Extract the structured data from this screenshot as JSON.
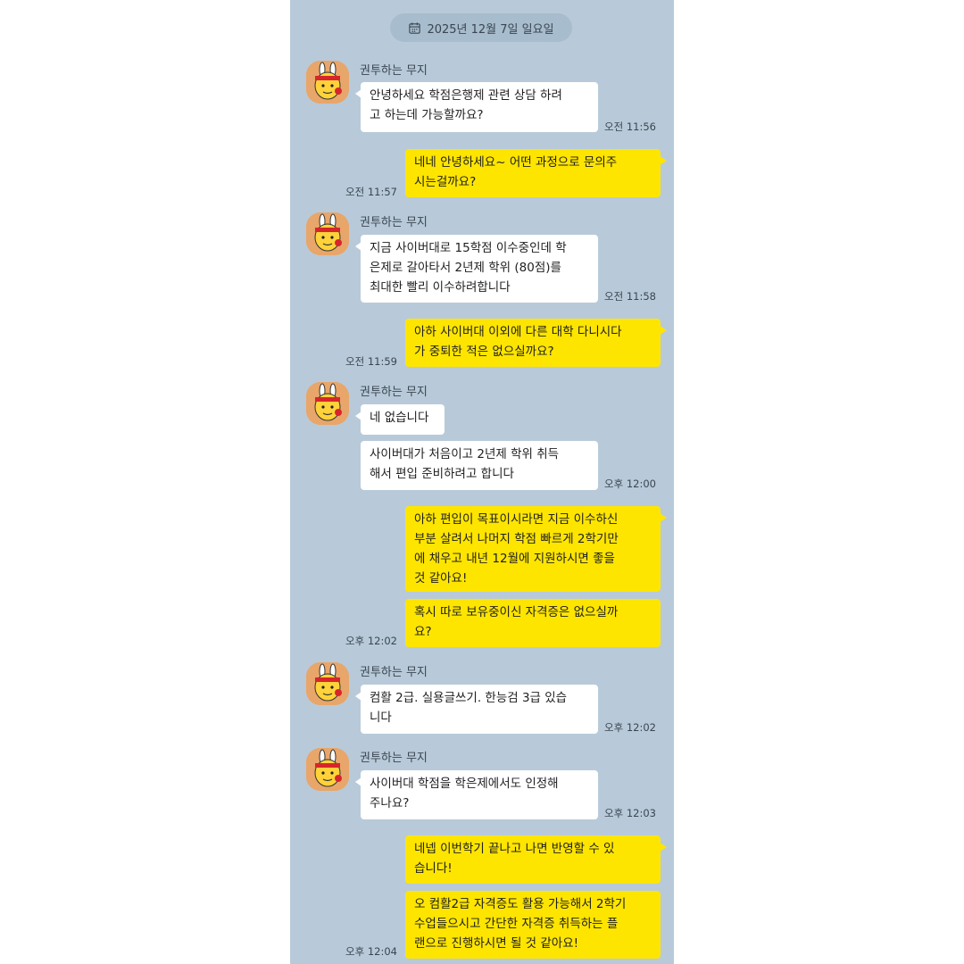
{
  "date_header": "2025년 12월 7일 일요일",
  "contact": {
    "name": "권투하는 무지"
  },
  "messages": [
    {
      "side": "in",
      "text": "안녕하세요 학점은행제 관련 상담 하려\n고 하는데 가능할까요?",
      "time": "오전 11:56"
    },
    {
      "side": "out",
      "text": "네네 안녕하세요~ 어떤 과정으로 문의주\n시는걸까요?",
      "time": "오전 11:57"
    },
    {
      "side": "in",
      "text": "지금 사이버대로 15학점 이수중인데 학\n은제로 갈아타서 2년제 학위 (80점)를\n최대한 빨리 이수하려합니다",
      "time": "오전 11:58"
    },
    {
      "side": "out",
      "text": "아하 사이버대 이외에 다른 대학 다니시다\n가 중퇴한 적은 없으실까요?",
      "time": "오전 11:59"
    },
    {
      "side": "in",
      "text": "네 없습니다",
      "time": ""
    },
    {
      "side": "in",
      "text": "사이버대가 처음이고 2년제 학위 취득\n해서 편입 준비하려고 합니다",
      "time": "오후 12:00"
    },
    {
      "side": "out",
      "text": "아하 편입이 목표이시라면 지금 이수하신\n부분 살려서 나머지 학점 빠르게 2학기만\n에 채우고 내년 12월에 지원하시면 좋을\n것 같아요!",
      "time": ""
    },
    {
      "side": "out",
      "text": "혹시 따로 보유중이신 자격증은 없으실까\n요?",
      "time": "오후 12:02"
    },
    {
      "side": "in",
      "text": "컴활 2급. 실용글쓰기. 한능검 3급 있습\n니다",
      "time": "오후 12:02"
    },
    {
      "side": "in",
      "text": "사이버대 학점을 학은제에서도 인정해\n주나요?",
      "time": "오후 12:03"
    },
    {
      "side": "out",
      "text": "네넵 이번학기 끝나고 나면 반영할 수 있\n습니다!",
      "time": ""
    },
    {
      "side": "out",
      "text": "오 컴활2급 자격증도 활용 가능해서 2학기\n 수업들으시고 간단한 자격증 취득하는 플\n랜으로 진행하시면 될 것 같아요!",
      "time": "오후 12:04"
    }
  ]
}
